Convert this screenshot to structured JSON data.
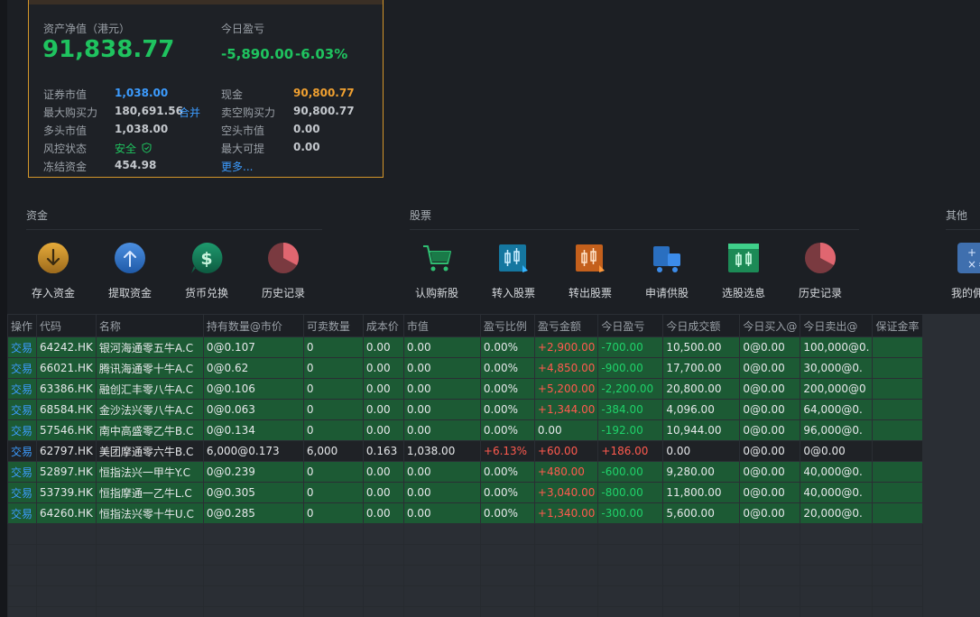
{
  "assets": {
    "net_label": "资产净值（港元）",
    "net_value": "91,838.77",
    "today_label": "今日盈亏",
    "today_value": "-5,890.00",
    "today_pct": "-6.03%",
    "rows_left": [
      {
        "label": "证券市值",
        "value": "1,038.00"
      },
      {
        "label": "最大购买力",
        "value": "180,691.56",
        "extra": "合并"
      },
      {
        "label": "多头市值",
        "value": "1,038.00"
      },
      {
        "label": "风控状态",
        "value": "安全"
      },
      {
        "label": "冻结资金",
        "value": "454.98"
      }
    ],
    "rows_right": [
      {
        "label": "现金",
        "value": "90,800.77"
      },
      {
        "label": "卖空购买力",
        "value": "90,800.77"
      },
      {
        "label": "空头市值",
        "value": "0.00"
      },
      {
        "label": "最大可提",
        "value": "0.00"
      },
      {
        "label": "",
        "value": "更多..."
      }
    ]
  },
  "sections": {
    "funds": {
      "title": "资金",
      "items": [
        "存入资金",
        "提取资金",
        "货币兑换",
        "历史记录"
      ]
    },
    "stocks": {
      "title": "股票",
      "items": [
        "认购新股",
        "转入股票",
        "转出股票",
        "申请供股",
        "选股选息",
        "历史记录"
      ]
    },
    "other": {
      "title": "其他",
      "items": [
        "我的佣"
      ]
    }
  },
  "colors": {
    "accent_blue": "#3c9cff",
    "profit_red": "#ff5a4e",
    "loss_green": "#1fc35f",
    "row_green": "#1c5a34",
    "card_border": "#d4962a"
  },
  "table": {
    "headers": [
      "操作",
      "代码",
      "名称",
      "持有数量@市价",
      "可卖数量",
      "成本价",
      "市值",
      "盈亏比例",
      "盈亏金额",
      "今日盈亏",
      "今日成交额",
      "今日买入@",
      "今日卖出@",
      "保证金率"
    ],
    "rows": [
      {
        "hl": true,
        "cells": [
          "交易",
          "64242.HK",
          "银河海通零五牛A.C",
          "0@0.107",
          "0",
          "0.00",
          "0.00",
          "0.00%",
          "+2,900.00",
          "-700.00",
          "10,500.00",
          "0@0.00",
          "100,000@0.",
          ""
        ]
      },
      {
        "hl": true,
        "cells": [
          "交易",
          "66021.HK",
          "腾讯海通零十牛A.C",
          "0@0.62",
          "0",
          "0.00",
          "0.00",
          "0.00%",
          "+4,850.00",
          "-900.00",
          "17,700.00",
          "0@0.00",
          "30,000@0.",
          ""
        ]
      },
      {
        "hl": true,
        "cells": [
          "交易",
          "63386.HK",
          "融创汇丰零八牛A.C",
          "0@0.106",
          "0",
          "0.00",
          "0.00",
          "0.00%",
          "+5,200.00",
          "-2,200.00",
          "20,800.00",
          "0@0.00",
          "200,000@0",
          ""
        ]
      },
      {
        "hl": true,
        "cells": [
          "交易",
          "68584.HK",
          "金沙法兴零八牛A.C",
          "0@0.063",
          "0",
          "0.00",
          "0.00",
          "0.00%",
          "+1,344.00",
          "-384.00",
          "4,096.00",
          "0@0.00",
          "64,000@0.",
          ""
        ]
      },
      {
        "hl": true,
        "cells": [
          "交易",
          "57546.HK",
          "南中高盛零乙牛B.C",
          "0@0.134",
          "0",
          "0.00",
          "0.00",
          "0.00%",
          "0.00",
          "-192.00",
          "10,944.00",
          "0@0.00",
          "96,000@0.",
          ""
        ]
      },
      {
        "hl": false,
        "cells": [
          "交易",
          "62797.HK",
          "美团摩通零六牛B.C",
          "6,000@0.173",
          "6,000",
          "0.163",
          "1,038.00",
          "+6.13%",
          "+60.00",
          "+186.00",
          "0.00",
          "0@0.00",
          "0@0.00",
          ""
        ]
      },
      {
        "hl": true,
        "cells": [
          "交易",
          "52897.HK",
          "恒指法兴一甲牛Y.C",
          "0@0.239",
          "0",
          "0.00",
          "0.00",
          "0.00%",
          "+480.00",
          "-600.00",
          "9,280.00",
          "0@0.00",
          "40,000@0.",
          ""
        ]
      },
      {
        "hl": true,
        "cells": [
          "交易",
          "53739.HK",
          "恒指摩通一乙牛L.C",
          "0@0.305",
          "0",
          "0.00",
          "0.00",
          "0.00%",
          "+3,040.00",
          "-800.00",
          "11,800.00",
          "0@0.00",
          "40,000@0.",
          ""
        ]
      },
      {
        "hl": true,
        "cells": [
          "交易",
          "64260.HK",
          "恒指法兴零十牛U.C",
          "0@0.285",
          "0",
          "0.00",
          "0.00",
          "0.00%",
          "+1,340.00",
          "-300.00",
          "5,600.00",
          "0@0.00",
          "20,000@0.",
          ""
        ]
      }
    ]
  }
}
